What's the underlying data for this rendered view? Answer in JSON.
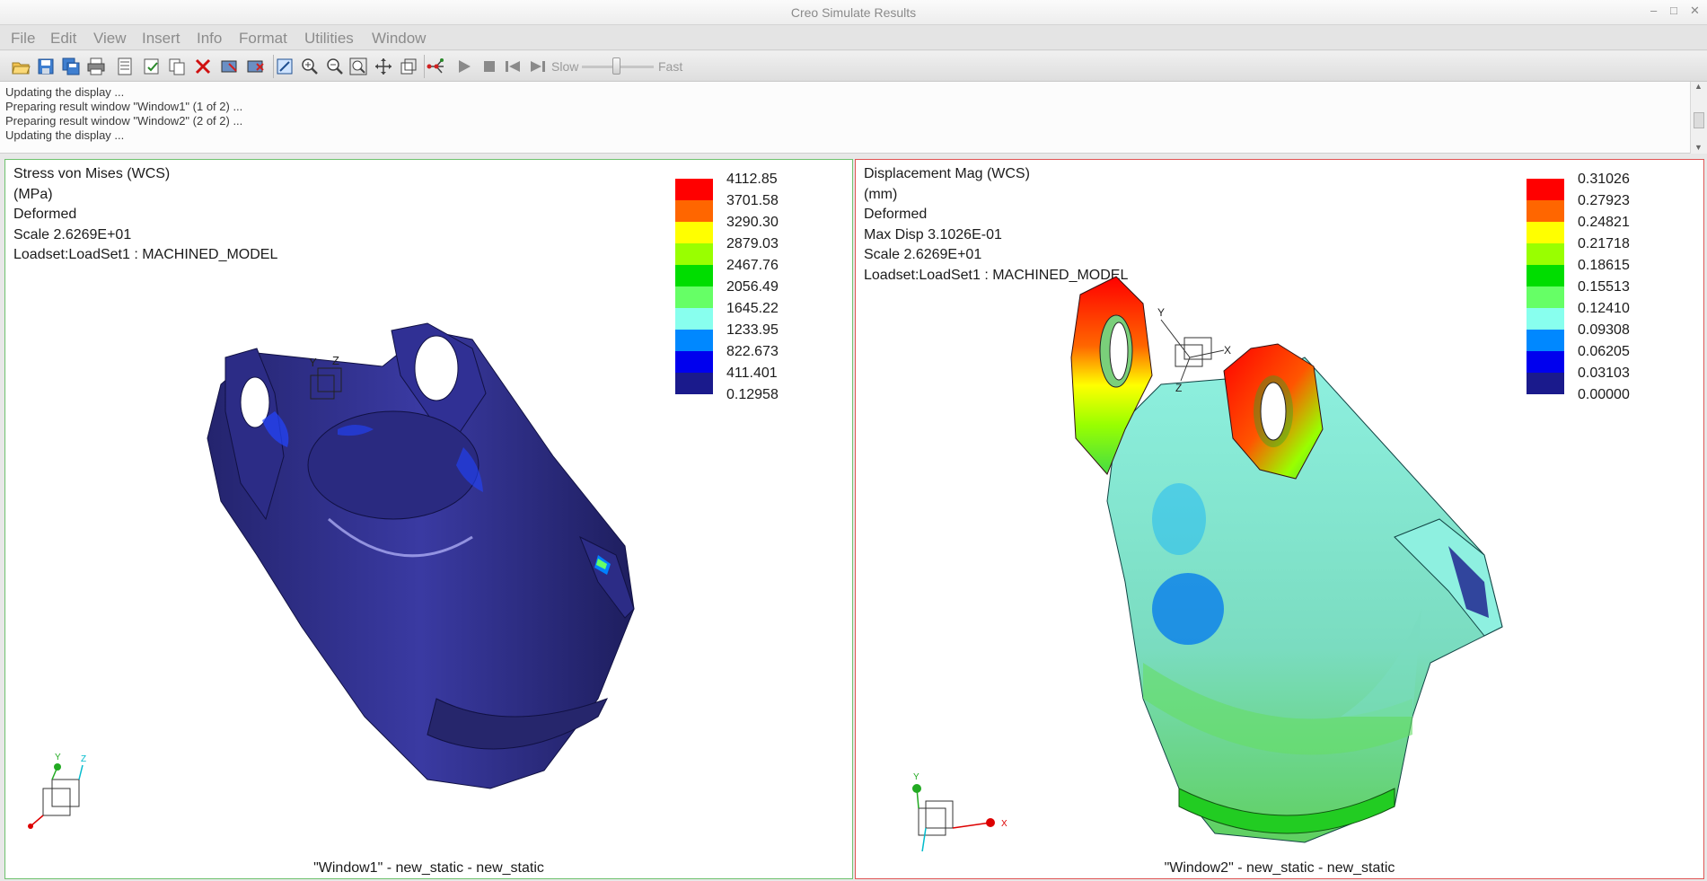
{
  "window": {
    "title": "Creo Simulate Results"
  },
  "menu": [
    "File",
    "Edit",
    "View",
    "Insert",
    "Info",
    "Format",
    "Utilities",
    "Window"
  ],
  "toolbar": {
    "icons": [
      "open-icon",
      "save-icon",
      "save-all-icon",
      "print-icon",
      "report-icon",
      "edit-definition-icon",
      "copy-icon",
      "delete-icon",
      "show-icon",
      "dynamic-query-icon",
      "refit-icon",
      "zoom-in-icon",
      "zoom-out-icon",
      "zoom-window-icon",
      "pan-icon",
      "reorient-icon",
      "node-query-icon",
      "play-icon",
      "stop-icon",
      "first-frame-icon",
      "next-frame-icon"
    ],
    "slow_label": "Slow",
    "fast_label": "Fast"
  },
  "messages": [
    "Updating the display ...",
    "Preparing result window \"Window1\" (1 of 2) ...",
    "Preparing result window \"Window2\" (2 of 2) ...",
    "Updating the display ..."
  ],
  "windows": [
    {
      "info": [
        "Stress von Mises (WCS)",
        "(MPa)",
        "Deformed",
        "Scale  2.6269E+01",
        "Loadset:LoadSet1 :  MACHINED_MODEL"
      ],
      "legend": [
        "4112.85",
        "3701.58",
        "3290.30",
        "2879.03",
        "2467.76",
        "2056.49",
        "1645.22",
        "1233.95",
        "822.673",
        "411.401",
        "0.12958"
      ],
      "footer": "\"Window1\" - new_static - new_static"
    },
    {
      "info": [
        "Displacement Mag (WCS)",
        "(mm)",
        "Deformed",
        "Max Disp  3.1026E-01",
        "Scale  2.6269E+01",
        "Loadset:LoadSet1 :  MACHINED_MODEL"
      ],
      "legend": [
        "0.31026",
        "0.27923",
        "0.24821",
        "0.21718",
        "0.18615",
        "0.15513",
        "0.12410",
        "0.09308",
        "0.06205",
        "0.03103",
        "0.00000"
      ],
      "footer": "\"Window2\" - new_static - new_static"
    }
  ],
  "legend_colors": [
    "#ff0000",
    "#ff6600",
    "#ffff00",
    "#99ff00",
    "#00dd00",
    "#66ff66",
    "#88ffee",
    "#00ccee",
    "#0088ff",
    "#0000ee",
    "#1a1a8c"
  ],
  "axis_labels": {
    "x": "X",
    "y": "Y",
    "z": "Z"
  }
}
